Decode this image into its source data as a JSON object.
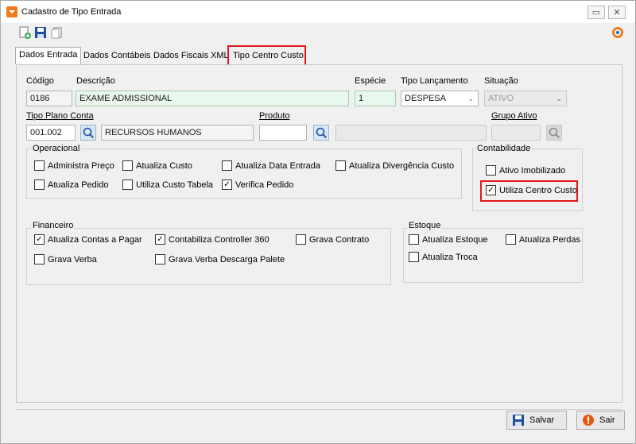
{
  "window": {
    "title": "Cadastro de Tipo Entrada",
    "restore_glyph": "▭",
    "close_glyph": "✕"
  },
  "toolbar": {
    "icons": [
      "new-document-icon",
      "save-disk-icon",
      "copy-icon",
      "help-icon"
    ]
  },
  "tabs": [
    {
      "label": "Dados Entrada"
    },
    {
      "label": "Dados Contábeis"
    },
    {
      "label": "Dados Fiscais"
    },
    {
      "label": "XML"
    },
    {
      "label": "Tipo Centro Custo"
    }
  ],
  "form": {
    "codigo_label": "Código",
    "codigo_value": "0186",
    "descricao_label": "Descrição",
    "descricao_value": "EXAME ADMISSIONAL",
    "especie_label": "Espécie",
    "especie_value": "1",
    "tipo_lancamento_label": "Tipo Lançamento",
    "tipo_lancamento_value": "DESPESA",
    "situacao_label": "Situação",
    "situacao_value": "ATIVO",
    "tipo_plano_label": "Tipo Plano Conta",
    "tipo_plano_value": "001.002",
    "tipo_plano_desc": "RECURSOS HUMANOS",
    "produto_label": "Produto",
    "produto_value": "",
    "produto_desc": "",
    "grupo_ativo_label": "Grupo Ativo",
    "grupo_ativo_value": ""
  },
  "operacional": {
    "label": "Operacional",
    "items": [
      {
        "label": "Administra Preço",
        "checked": false
      },
      {
        "label": "Atualiza Custo",
        "checked": false
      },
      {
        "label": "Atualiza Data Entrada",
        "checked": false
      },
      {
        "label": "Atualiza Divergência Custo",
        "checked": false
      },
      {
        "label": "Atualiza Pedido",
        "checked": false
      },
      {
        "label": "Utiliza Custo Tabela",
        "checked": false
      },
      {
        "label": "Verifica Pedido",
        "checked": true
      }
    ]
  },
  "contabilidade": {
    "label": "Contabilidade",
    "items": [
      {
        "label": "Ativo Imobilizado",
        "checked": false
      },
      {
        "label": "Utiliza Centro Custo",
        "checked": true
      }
    ]
  },
  "financeiro": {
    "label": "Financeiro",
    "items": [
      {
        "label": "Atualiza Contas a Pagar",
        "checked": true
      },
      {
        "label": "Contabiliza Controller 360",
        "checked": true
      },
      {
        "label": "Grava Contrato",
        "checked": false
      },
      {
        "label": "Grava Verba",
        "checked": false
      },
      {
        "label": "Grava Verba Descarga Palete",
        "checked": false
      }
    ]
  },
  "estoque": {
    "label": "Estoque",
    "items": [
      {
        "label": "Atualiza Estoque",
        "checked": false
      },
      {
        "label": "Atualiza Perdas",
        "checked": false
      },
      {
        "label": "Atualiza Troca",
        "checked": false
      }
    ]
  },
  "footer": {
    "salvar_label": "Salvar",
    "sair_label": "Sair"
  },
  "colors": {
    "highlight": "#e0171e",
    "accent": "#f07a1e"
  }
}
